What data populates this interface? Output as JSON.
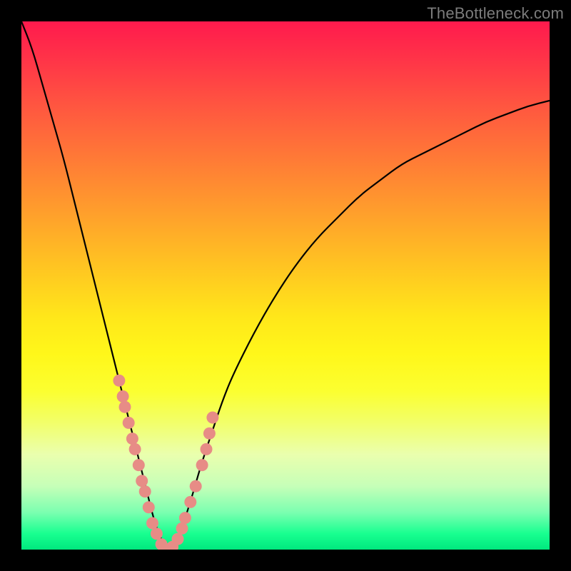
{
  "watermark": "TheBottleneck.com",
  "chart_data": {
    "type": "line",
    "title": "",
    "xlabel": "",
    "ylabel": "",
    "xlim": [
      0,
      100
    ],
    "ylim": [
      0,
      100
    ],
    "x": [
      0,
      2,
      4,
      6,
      8,
      10,
      12,
      14,
      16,
      18,
      20,
      22,
      24,
      25,
      26,
      27,
      28,
      29,
      30,
      32,
      34,
      36,
      38,
      40,
      44,
      48,
      52,
      56,
      60,
      64,
      68,
      72,
      76,
      80,
      84,
      88,
      92,
      96,
      100
    ],
    "y": [
      100,
      95,
      88,
      81,
      74,
      66,
      58,
      50,
      42,
      34,
      26,
      18,
      10,
      6,
      3,
      1,
      0,
      1,
      3,
      9,
      16,
      22,
      28,
      33,
      41,
      48,
      54,
      59,
      63,
      67,
      70,
      73,
      75,
      77,
      79,
      81,
      82.5,
      84,
      85
    ],
    "marker_points": {
      "x": [
        18.5,
        19.2,
        19.6,
        20.3,
        21.0,
        21.5,
        22.2,
        22.8,
        23.4,
        24.1,
        24.8,
        25.6,
        26.5,
        27.5,
        28.6,
        29.6,
        30.4,
        31.0,
        32.0,
        33.0,
        34.2,
        35.0,
        35.6,
        36.2
      ],
      "y": [
        32,
        29,
        27,
        24,
        21,
        19,
        16,
        13,
        11,
        8,
        5,
        3,
        1,
        0,
        0.5,
        2,
        4,
        6,
        9,
        12,
        16,
        19,
        22,
        25
      ]
    }
  }
}
